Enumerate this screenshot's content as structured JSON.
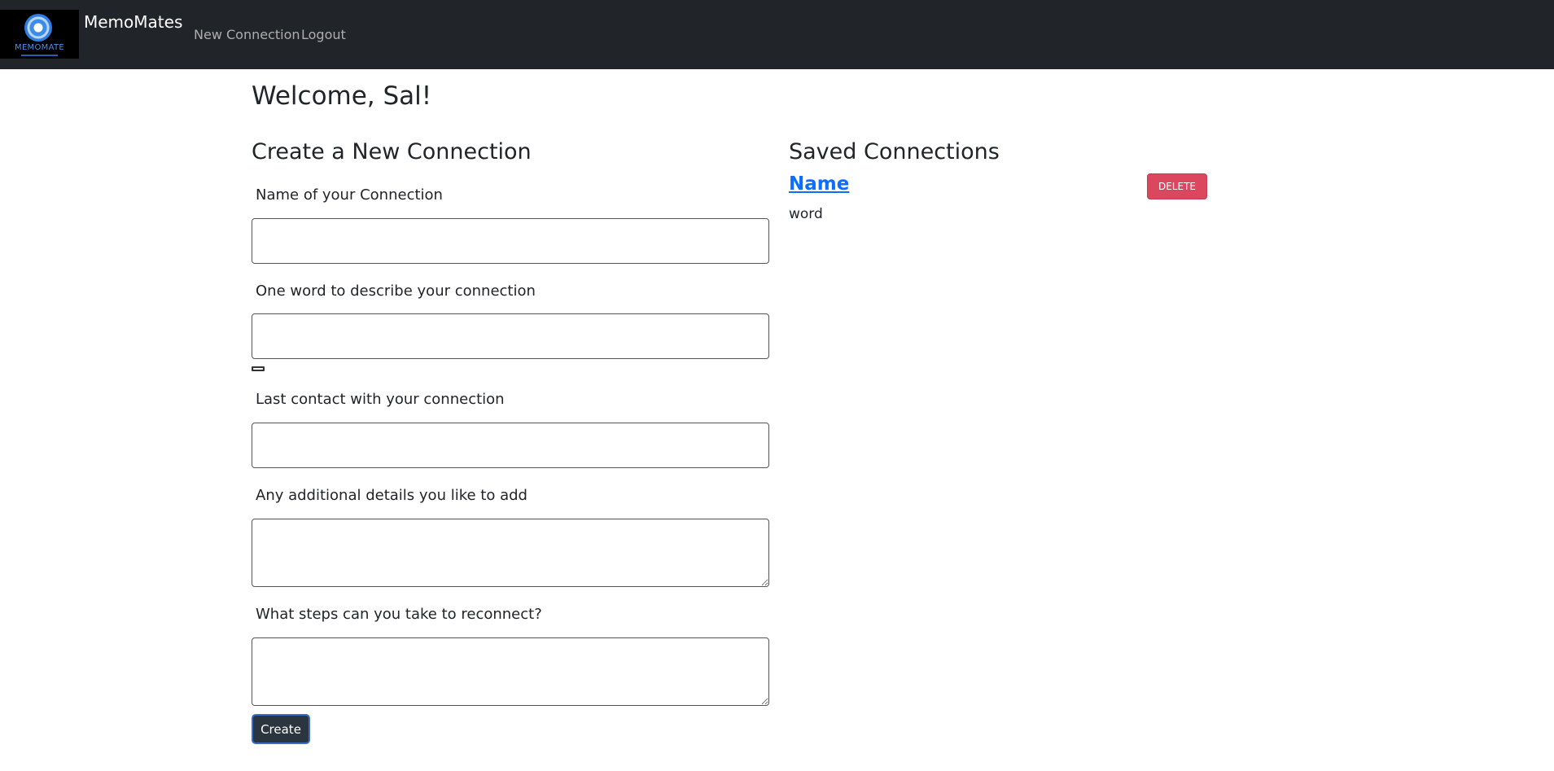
{
  "navbar": {
    "logo_text": "MEMOMATE",
    "brand": "MemoMates",
    "links": [
      "New Connection",
      "Logout"
    ]
  },
  "main": {
    "welcome": "Welcome, Sal!",
    "create_title": "Create a New Connection",
    "saved_title": "Saved Connections"
  },
  "form": {
    "fields": [
      {
        "label": "Name of your Connection",
        "value": ""
      },
      {
        "label": "One word to describe your connection",
        "value": ""
      },
      {
        "label": "Last contact with your connection",
        "value": ""
      },
      {
        "label": "Any additional details you like to add",
        "value": ""
      },
      {
        "label": "What steps can you take to reconnect?",
        "value": ""
      }
    ],
    "submit_label": "Create"
  },
  "saved": {
    "items": [
      {
        "name": "Name",
        "word": "word",
        "delete_label": "DELETE"
      }
    ]
  },
  "colors": {
    "navbar_bg": "#212529",
    "link_blue": "#0d6efd",
    "delete_red": "#dc4760",
    "create_btn_bg": "#2b3540"
  }
}
